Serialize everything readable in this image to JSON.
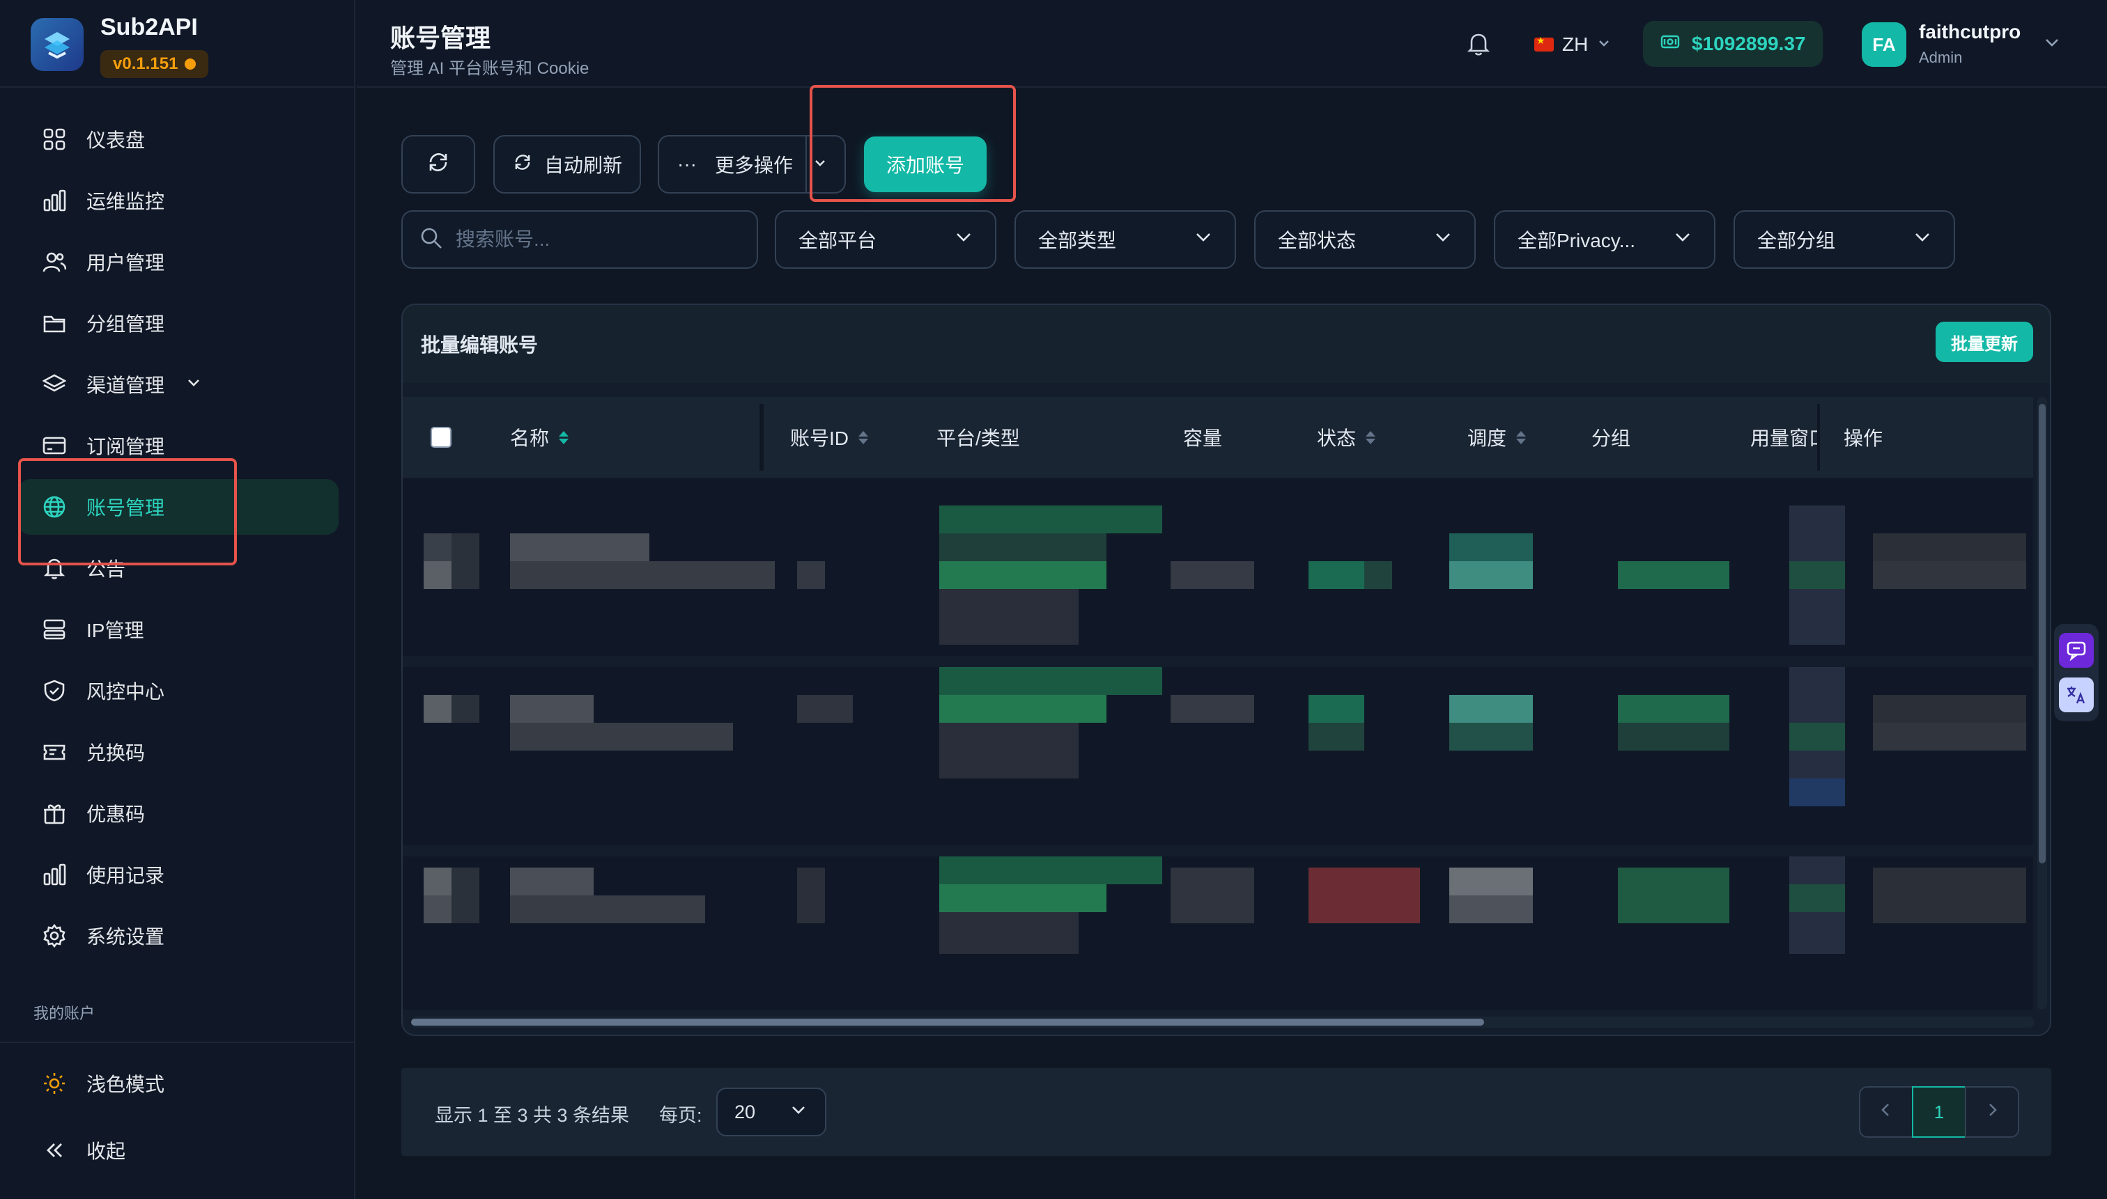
{
  "app": {
    "name": "Sub2API",
    "version": "v0.1.151"
  },
  "sidebar": {
    "items": [
      {
        "label": "仪表盘",
        "icon": "dashboard-grid-icon"
      },
      {
        "label": "运维监控",
        "icon": "bar-chart-icon"
      },
      {
        "label": "用户管理",
        "icon": "users-icon"
      },
      {
        "label": "分组管理",
        "icon": "folder-icon"
      },
      {
        "label": "渠道管理",
        "icon": "layers-icon"
      },
      {
        "label": "订阅管理",
        "icon": "credit-card-icon"
      },
      {
        "label": "账号管理",
        "icon": "globe-icon",
        "active": true
      },
      {
        "label": "公告",
        "icon": "bell-icon"
      },
      {
        "label": "IP管理",
        "icon": "server-icon"
      },
      {
        "label": "风控中心",
        "icon": "shield-icon"
      },
      {
        "label": "兑换码",
        "icon": "ticket-icon"
      },
      {
        "label": "优惠码",
        "icon": "gift-icon"
      },
      {
        "label": "使用记录",
        "icon": "bar-chart-icon"
      },
      {
        "label": "系统设置",
        "icon": "gear-icon"
      }
    ],
    "section_label": "我的账户",
    "theme_toggle": "浅色模式",
    "collapse": "收起"
  },
  "header": {
    "title": "账号管理",
    "subtitle": "管理 AI 平台账号和 Cookie",
    "language": "ZH",
    "balance": "$1092899.37",
    "user": {
      "initials": "FA",
      "name": "faithcutpro",
      "role": "Admin"
    }
  },
  "toolbar": {
    "auto_refresh": "自动刷新",
    "more_actions_glyph": "···",
    "more_actions": "更多操作",
    "add_account": "添加账号"
  },
  "filters": {
    "search_placeholder": "搜索账号...",
    "platform": "全部平台",
    "type": "全部类型",
    "status": "全部状态",
    "privacy": "全部Privacy...",
    "group": "全部分组"
  },
  "table": {
    "card_title": "批量编辑账号",
    "bulk_update": "批量更新",
    "columns": [
      "名称",
      "账号ID",
      "平台/类型",
      "容量",
      "状态",
      "调度",
      "分组",
      "用量窗口",
      "操作"
    ],
    "row_count": 3
  },
  "pagination": {
    "summary": "显示 1 至 3 共 3 条结果",
    "per_page_label": "每页:",
    "per_page": "20",
    "current_page": "1"
  },
  "colors": {
    "accent": "#14b8a6",
    "background": "#0f1724",
    "highlight_box": "#e5534b"
  }
}
